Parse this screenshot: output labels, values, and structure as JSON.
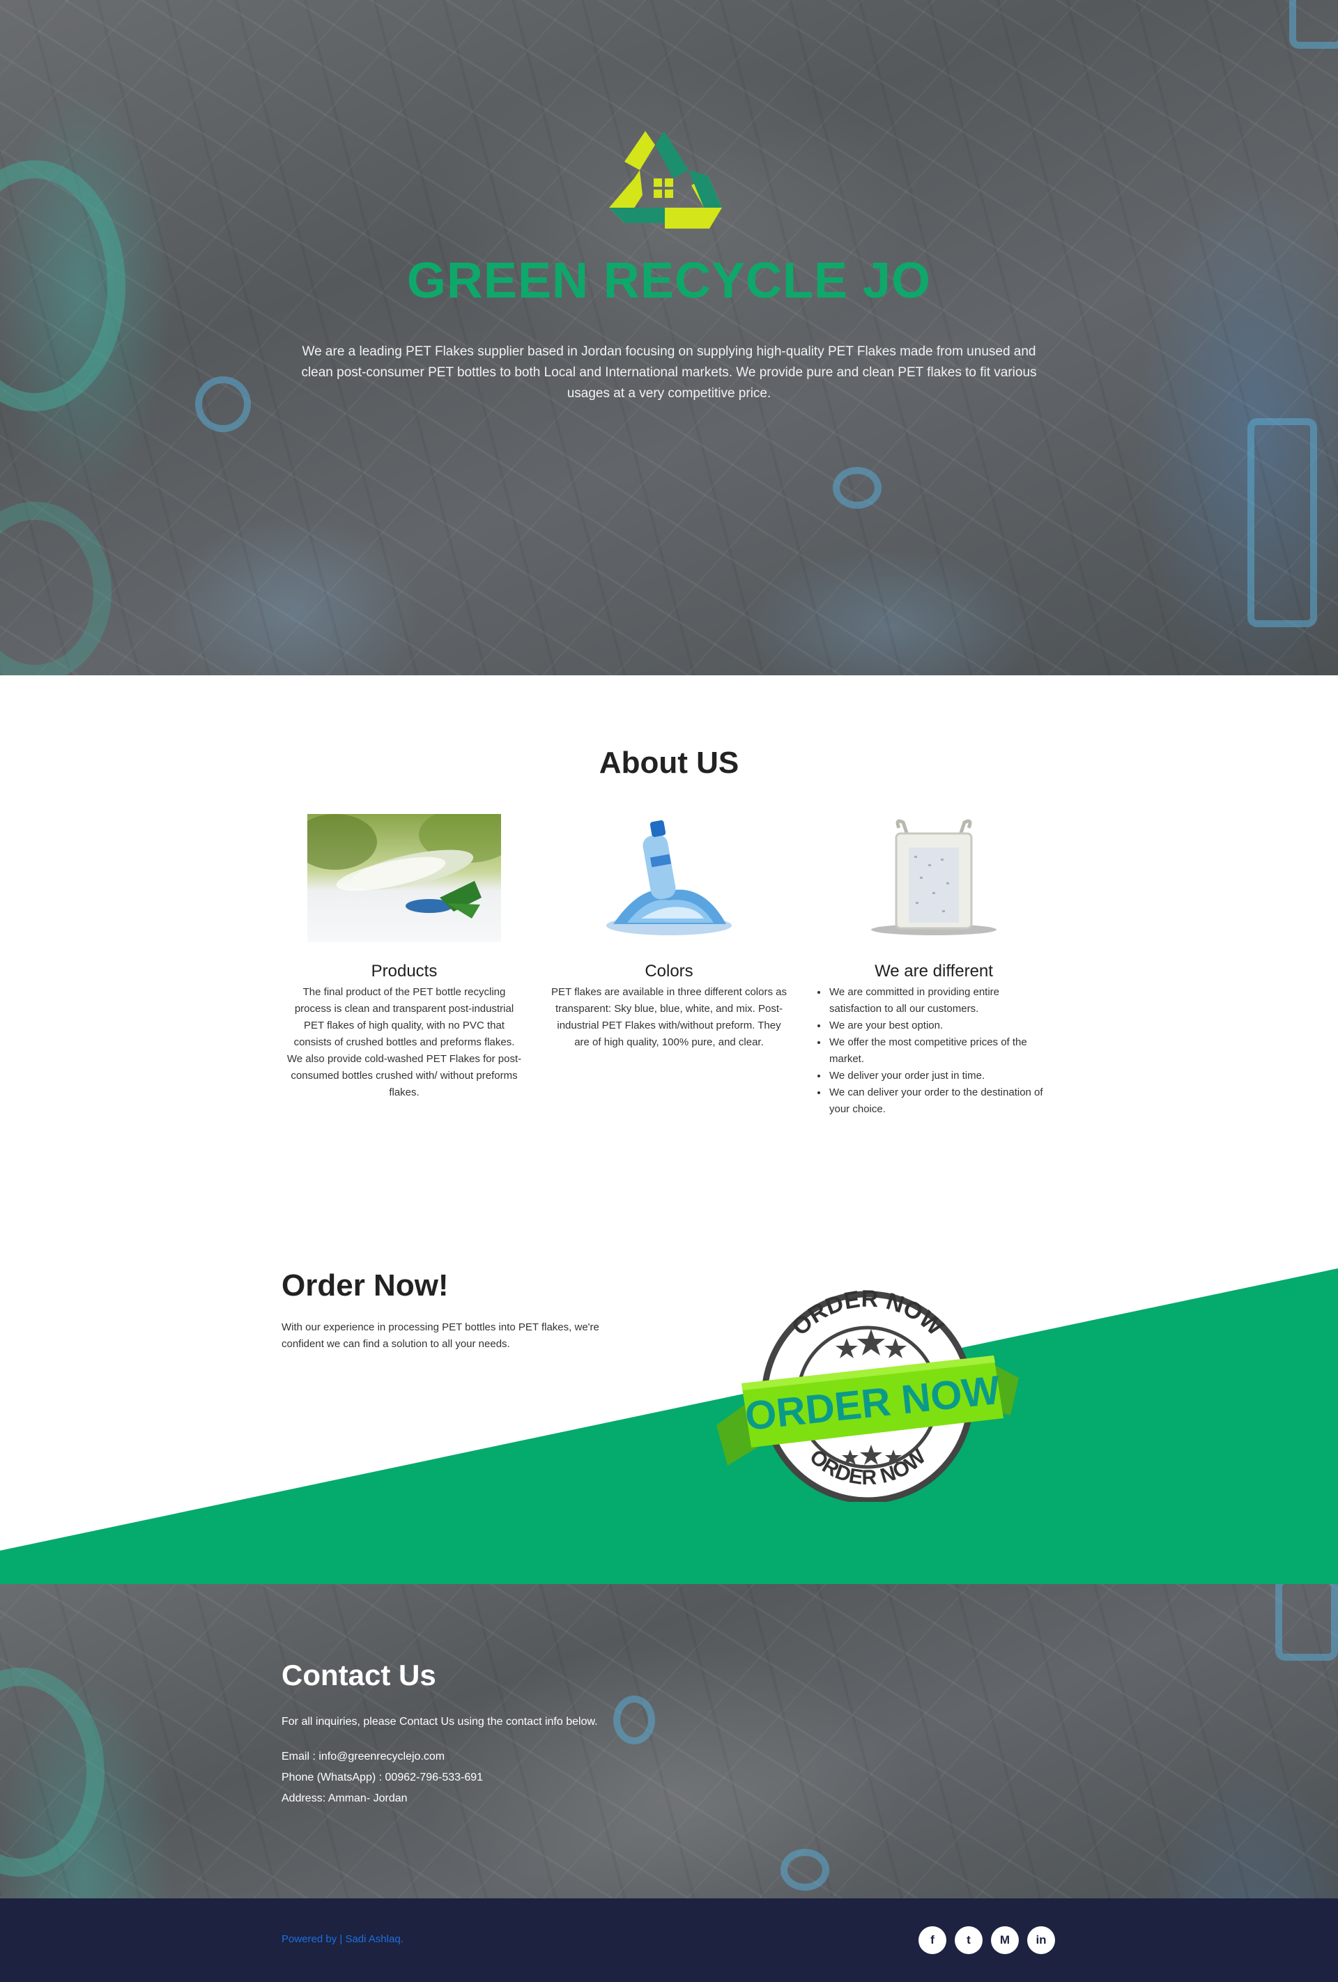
{
  "hero": {
    "title": "GREEN RECYCLE JO",
    "description": "We are a leading PET Flakes supplier based in Jordan focusing on supplying high-quality PET Flakes made from unused and clean post-consumer PET bottles to both Local and International markets. We provide pure and clean PET flakes to fit various usages at a very competitive price."
  },
  "about": {
    "title": "About US",
    "cards": [
      {
        "title": "Products",
        "text": "The final product of the PET bottle recycling process is clean and transparent post-industrial PET flakes of high quality, with no PVC that consists of crushed bottles and preforms flakes. We also provide cold-washed PET Flakes for post-consumed bottles crushed with/ without preforms flakes."
      },
      {
        "title": "Colors",
        "text": "PET flakes are available in three different colors as transparent: Sky blue, blue, white, and mix. Post-industrial PET Flakes with/without preform. They are of high quality, 100% pure, and clear."
      },
      {
        "title": "We are different",
        "items": [
          "We are committed in providing entire satisfaction to all our customers.",
          "We are your best option.",
          "We offer the most competitive prices of the market.",
          "We deliver your order just in time.",
          "We can deliver your order to the destination of your choice."
        ]
      }
    ]
  },
  "order": {
    "title": "Order Now!",
    "description": "With our experience in processing PET bottles into PET flakes, we're confident we can find a solution to all your needs.",
    "stamp_top": "ORDER NOW",
    "stamp_center": "ORDER NOW",
    "stamp_bottom": "ORDER NOW"
  },
  "contact": {
    "title": "Contact Us",
    "intro": "For all inquiries, please Contact Us using the contact info below.",
    "email": "Email : info@greenrecyclejo.com",
    "phone": "Phone (WhatsApp) : 00962-796-533-691",
    "address": "Address: Amman- Jordan"
  },
  "footer": {
    "powered": "Powered by | Sadi Ashlaq.",
    "social": [
      "facebook-icon",
      "twitter-icon",
      "medium-icon",
      "linkedin-icon"
    ],
    "social_glyphs": [
      "f",
      "t",
      "M",
      "in"
    ]
  },
  "colors": {
    "brand_green": "#05aa6d",
    "footer_navy": "#1c2240",
    "link_blue": "#1e6fe0",
    "logo_lime": "#d4e61a",
    "logo_teal": "#1c8f6e"
  }
}
